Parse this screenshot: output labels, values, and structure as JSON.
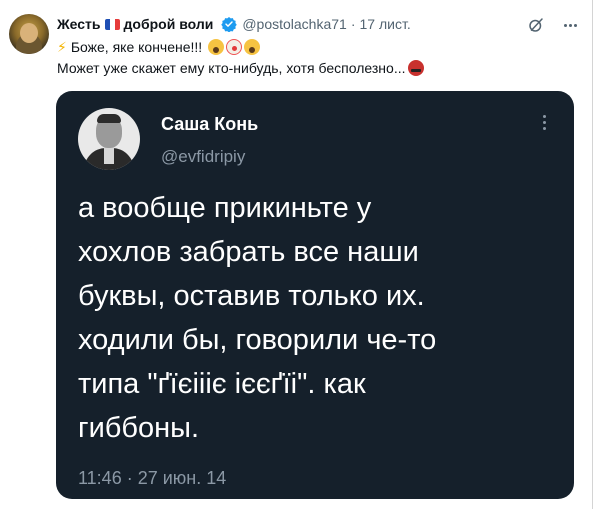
{
  "post": {
    "display_name_prefix": "Жесть",
    "display_name_suffix": "доброй воли",
    "handle": "@postolachka71",
    "separator": "·",
    "date": "17 лист.",
    "text_line1": "Боже, яке кончене!!!",
    "text_line2": "Может уже скажет ему кто-нибудь, хотя бесполезно...",
    "emojis_line1": [
      "face-screaming",
      "clown-face",
      "face-screaming"
    ],
    "emoji_line2": "face-with-symbols-on-mouth",
    "icons": [
      "lightning-icon",
      "flag-france-icon",
      "verified-badge-icon",
      "grok-icon",
      "more-icon"
    ]
  },
  "embedded_tweet": {
    "name": "Саша Конь",
    "handle": "@evfidripiy",
    "text_lines": [
      "а вообще прикиньте у",
      "хохлов забрать все наши",
      "буквы, оставив только их.",
      "ходили бы, говорили че-то",
      "типа \"ґїєіііє ієєґїі\". как",
      "гиббоны."
    ],
    "timestamp": "11:46 · 27 июн. 14"
  },
  "colors": {
    "background": "#ffffff",
    "text": "#0f1419",
    "secondary_text": "#536471",
    "verified_blue": "#1d9bf0",
    "embed_background": "#15202b",
    "embed_secondary": "#8b98a5"
  }
}
